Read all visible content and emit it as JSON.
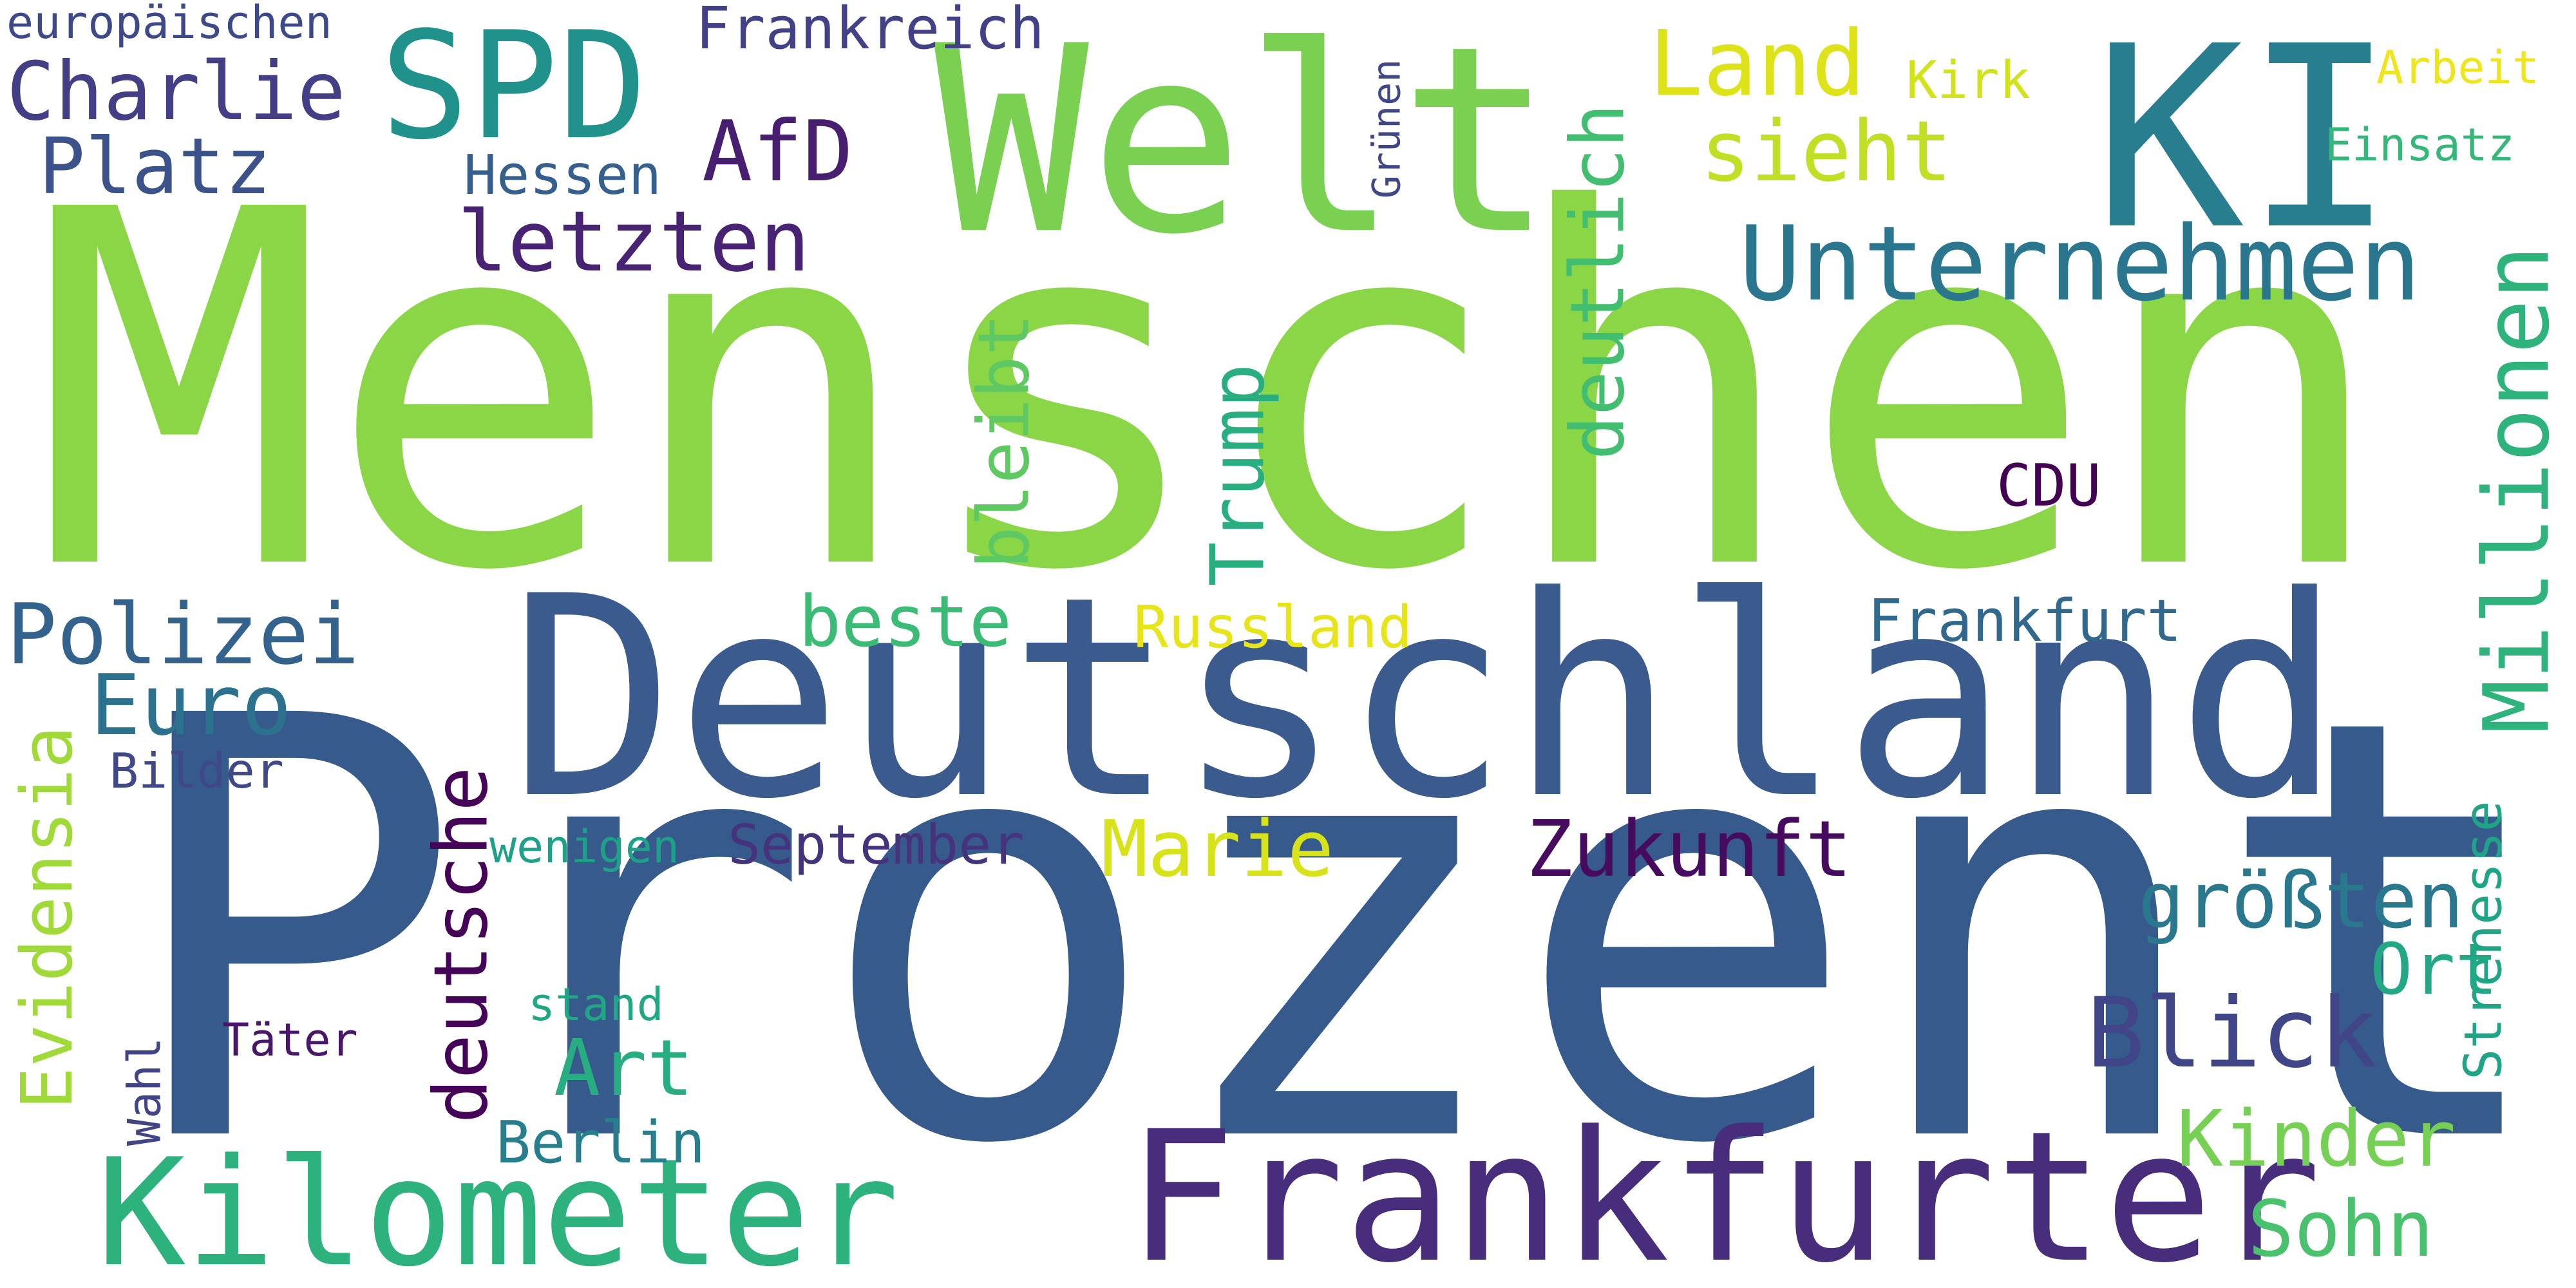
{
  "words": [
    {
      "key": "menschen",
      "text": "Menschen",
      "color": "#8bd646"
    },
    {
      "key": "prozent",
      "text": "Prozent",
      "color": "#375a8c"
    },
    {
      "key": "deutschland",
      "text": "Deutschland",
      "color": "#3b5a8d"
    },
    {
      "key": "welt",
      "text": "Welt",
      "color": "#7ad151"
    },
    {
      "key": "ki",
      "text": "KI",
      "color": "#287d8e"
    },
    {
      "key": "frankfurter",
      "text": "Frankfurter",
      "color": "#472d7b"
    },
    {
      "key": "kilometer",
      "text": "Kilometer",
      "color": "#2db27d"
    },
    {
      "key": "spd",
      "text": "SPD",
      "color": "#21918c"
    },
    {
      "key": "unternehmen",
      "text": "Unternehmen",
      "color": "#2a768e"
    },
    {
      "key": "millionen",
      "text": "Millionen",
      "color": "#2eb37c"
    },
    {
      "key": "land",
      "text": "Land",
      "color": "#dde318"
    },
    {
      "key": "sieht",
      "text": "sieht",
      "color": "#c0df25"
    },
    {
      "key": "charlie",
      "text": "Charlie",
      "color": "#433e85"
    },
    {
      "key": "platz",
      "text": "Platz",
      "color": "#3b528b"
    },
    {
      "key": "europaeischen",
      "text": "europäischen",
      "color": "#3e4989"
    },
    {
      "key": "frankreich",
      "text": "Frankreich",
      "color": "#424086"
    },
    {
      "key": "hessen",
      "text": "Hessen",
      "color": "#355f8d"
    },
    {
      "key": "afd",
      "text": "AfD",
      "color": "#481f70"
    },
    {
      "key": "letzten",
      "text": "letzten",
      "color": "#482374"
    },
    {
      "key": "gruenen",
      "text": "Grünen",
      "color": "#3f4788"
    },
    {
      "key": "kirk",
      "text": "Kirk",
      "color": "#d2e21b"
    },
    {
      "key": "arbeit",
      "text": "Arbeit",
      "color": "#efe51c"
    },
    {
      "key": "einsatz",
      "text": "Einsatz",
      "color": "#35b779"
    },
    {
      "key": "deutlich",
      "text": "deutlich",
      "color": "#42be71"
    },
    {
      "key": "bleibt",
      "text": "bleibt",
      "color": "#5ec962"
    },
    {
      "key": "trump",
      "text": "Trump",
      "color": "#29af7f"
    },
    {
      "key": "cdu",
      "text": "CDU",
      "color": "#440154"
    },
    {
      "key": "polizei",
      "text": "Polizei",
      "color": "#33638d"
    },
    {
      "key": "beste",
      "text": "beste",
      "color": "#3bbb75"
    },
    {
      "key": "russland",
      "text": "Russland",
      "color": "#e7e419"
    },
    {
      "key": "frankfurt",
      "text": "Frankfurt",
      "color": "#31688e"
    },
    {
      "key": "euro",
      "text": "Euro",
      "color": "#2c728e"
    },
    {
      "key": "bilder",
      "text": "Bilder",
      "color": "#3f4889"
    },
    {
      "key": "evidensia",
      "text": "Evidensia",
      "color": "#a0da39"
    },
    {
      "key": "deutsche",
      "text": "deutsche",
      "color": "#450457"
    },
    {
      "key": "wenigen",
      "text": "wenigen",
      "color": "#1fa088"
    },
    {
      "key": "september",
      "text": "September",
      "color": "#46337e"
    },
    {
      "key": "marie",
      "text": "Marie",
      "color": "#d8e219"
    },
    {
      "key": "zukunft",
      "text": "Zukunft",
      "color": "#460b5e"
    },
    {
      "key": "groessten",
      "text": "größten",
      "color": "#2a788e"
    },
    {
      "key": "ort",
      "text": "Ort",
      "color": "#22a884"
    },
    {
      "key": "strenesse",
      "text": "Strenesse",
      "color": "#20a486"
    },
    {
      "key": "stand",
      "text": "stand",
      "color": "#22a785"
    },
    {
      "key": "taeter",
      "text": "Täter",
      "color": "#481769"
    },
    {
      "key": "wahl",
      "text": "Wahl",
      "color": "#414487"
    },
    {
      "key": "art",
      "text": "Art",
      "color": "#27ad81"
    },
    {
      "key": "blick",
      "text": "Blick",
      "color": "#404588"
    },
    {
      "key": "berlin",
      "text": "Berlin",
      "color": "#277f8e"
    },
    {
      "key": "kinder",
      "text": "Kinder",
      "color": "#75d054"
    },
    {
      "key": "sohn",
      "text": "Sohn",
      "color": "#4ac16d"
    }
  ]
}
